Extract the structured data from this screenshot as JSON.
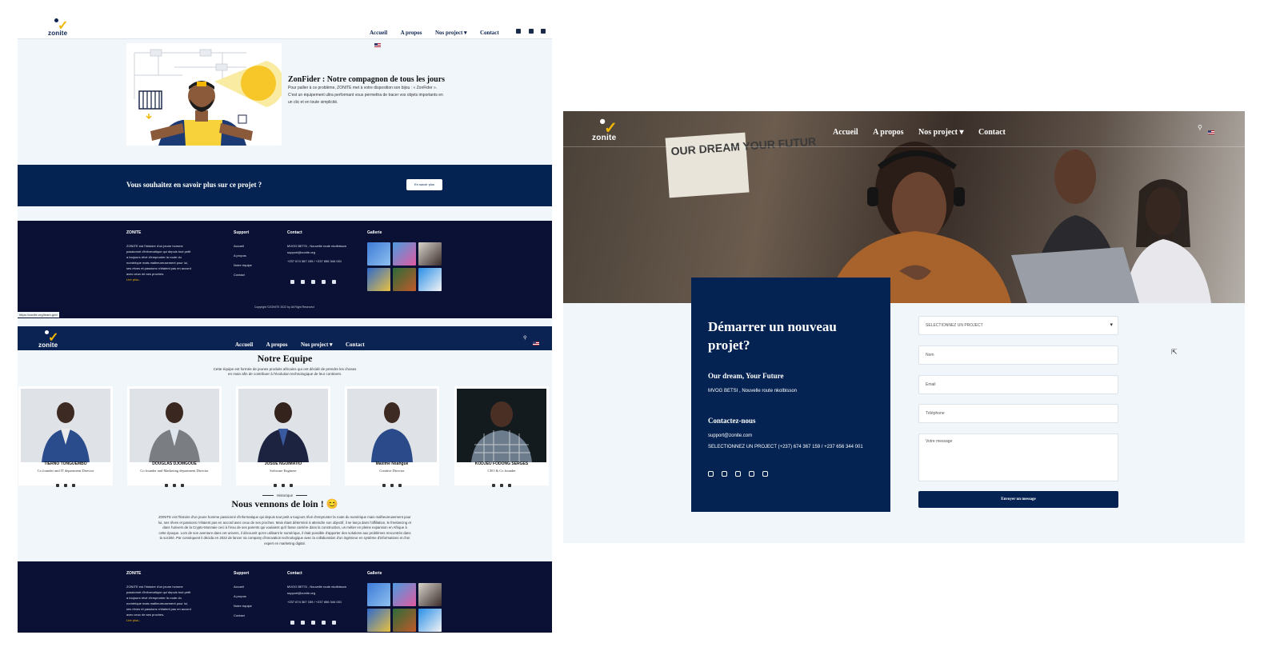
{
  "brand": {
    "logo_text": "zonite"
  },
  "nav": {
    "home": "Accueil",
    "about": "A propos",
    "projects": "Nos project",
    "contact": "Contact"
  },
  "zonfider": {
    "title": "ZonFider : Notre compagnon de tous les jours",
    "text": "Pour pallier à ce problème, ZONITE met à votre disposition son bijou : « ZonFider ». C'est un équipement ultra performant vous permettra de tracer vos objets importants en un clic et en toute simplicité."
  },
  "band": {
    "question": "Vous souhaitez en savoir plus sur ce projet ?",
    "button": "En savoir plus"
  },
  "footer": {
    "brand_title": "ZONITE",
    "about_text": "ZONITE est l'histoire d'un jeune homme passionné d'informatique qui depuis tout petit a toujours rêvé d'emprunter la route du numérique mais malheureusement pour lui, ses rêves et passions n'étaient pas en accord avec ceux de ses proches.",
    "read_more": "Lire plus...",
    "support_title": "Support",
    "support_items": [
      "Accueil",
      "A propos",
      "Notre équipe",
      "Contact"
    ],
    "contact_title": "Contact",
    "address": "MVOG BETSI , Nouvelle route nkolbisson",
    "email": "support@zonite.org",
    "phone": "+237 674 367 159 / +237 656 344 001",
    "gallery_title": "Gallerie",
    "copyright": "Copyright ©ZONITE 2022 by All Right Reserved"
  },
  "status_url": "https://zonite.org/team-grid",
  "team": {
    "title": "Notre Equipe",
    "subtitle": "Cette équipe est formée de jeunes produits africains qui ont décidé de prendre les choses en main afin de contribuer à l'évolution technologique de leur continent.",
    "members": [
      {
        "name": "TIERNO TONGUEMBO",
        "role": "Co founder and IT department Director"
      },
      {
        "name": "DOUGLAS DJOMGOUE",
        "role": "Co founder and Marketing department Director"
      },
      {
        "name": "JOSUE NGUIMATIO",
        "role": "Software Engineer"
      },
      {
        "name": "Maxime Nsahgue",
        "role": "Creative Director"
      },
      {
        "name": "KODJEU FODONG SERGES",
        "role": "CEO & Co founder"
      }
    ]
  },
  "history": {
    "tag": "Historique",
    "title": "Nous vennons de loin ! 😊",
    "text": "ZONITE est l'histoire d'un jeune homme passionné d'informatique qui depuis tout petit a toujours rêvé d'emprunter la route du numérique mais malheureusement pour lui, ses rêves et passions n'étaient pas en accord avec ceux de ses proches. Mais étant déterminé à atteindre son objectif, il se lança dans l'affiliation, le freelancing et dans l'univers de la Crypto-Monnaie ceci à l'insu de ses parents qui voulaient qu'il fasse carrière dans la construction, un métier en pleine expansion en Afrique à cette époque. Lors de son aventure dans cet univers, il découvrit qu'en utilisant le numérique, il était possible d'apporter des solutions aux problèmes rencontrés dans la société. Par conséquent il décida en 2022 de lancer sa company d'innovation technologique avec la collaboration d'un ingénieur en système d'informations et d'un expert en marketing digital."
  },
  "hero": {
    "sign_text": "OUR DREAM YOUR FUTUR"
  },
  "start_project": {
    "title": "Démarrer un nouveau projet?",
    "dream": "Our dream, Your Future",
    "address": "MVOG BETSI , Nouvelle route nkolbisson",
    "contact_title": "Contactez-nous",
    "email": "support@zonite.com",
    "phone": "SELECTIONNEZ UN PROJECT (+237) 674 367 159 / +237 656 344 001"
  },
  "form": {
    "select": "SELECTIONNEZ UN PROJECT",
    "name_placeholder": "Nom",
    "email_placeholder": "Email",
    "phone_placeholder": "Téléphone",
    "message_placeholder": "Votre message",
    "submit": "Envoyer un message"
  },
  "colors": {
    "navy": "#052352",
    "footer_bg": "#0b1134",
    "accent_yellow": "#f2b705",
    "page_bg": "#f1f6fb"
  }
}
